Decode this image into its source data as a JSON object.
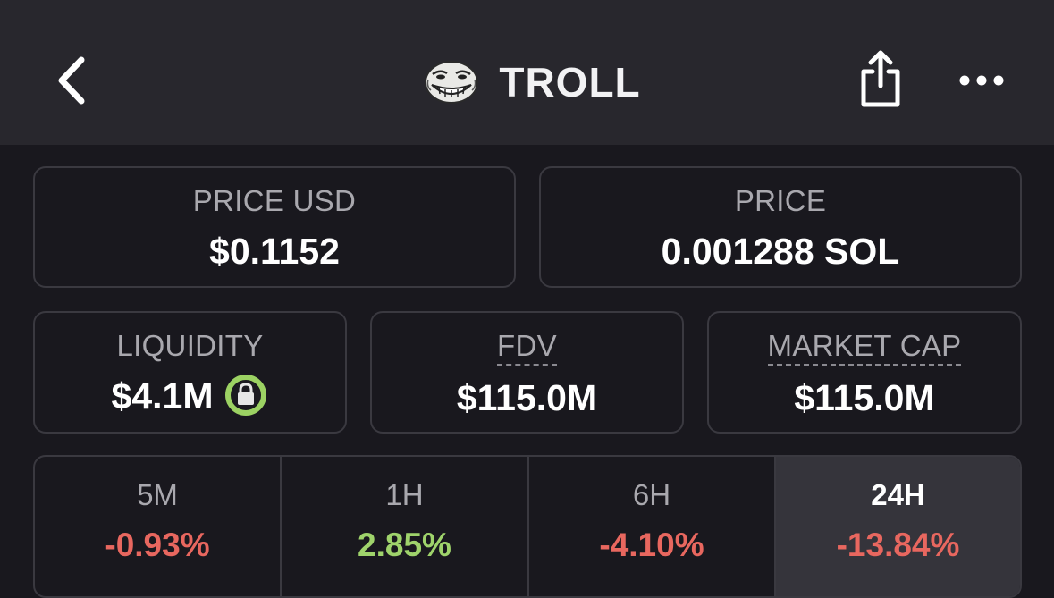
{
  "header": {
    "title": "TROLL",
    "icons": {
      "back": "chevron-left-icon",
      "logo": "troll-face-logo",
      "share": "share-icon",
      "more": "more-horizontal-icon"
    }
  },
  "stats": {
    "price_usd": {
      "label": "PRICE USD",
      "value": "$0.1152"
    },
    "price_native": {
      "label": "PRICE",
      "value": "0.001288 SOL"
    },
    "liquidity": {
      "label": "LIQUIDITY",
      "value": "$4.1M",
      "badge_icon": "lock-icon"
    },
    "fdv": {
      "label": "FDV",
      "value": "$115.0M"
    },
    "market_cap": {
      "label": "MARKET CAP",
      "value": "$115.0M"
    }
  },
  "timeframes": [
    {
      "label": "5M",
      "change": "-0.93%",
      "direction": "down"
    },
    {
      "label": "1H",
      "change": "2.85%",
      "direction": "up"
    },
    {
      "label": "6H",
      "change": "-4.10%",
      "direction": "down"
    },
    {
      "label": "24H",
      "change": "-13.84%",
      "direction": "down",
      "selected": true
    }
  ],
  "colors": {
    "header_bg": "#28272d",
    "page_bg": "#19181e",
    "card_border": "#3a3940",
    "positive": "#9fd36b",
    "negative": "#e8675f",
    "lock_ring": "#9cd263"
  }
}
